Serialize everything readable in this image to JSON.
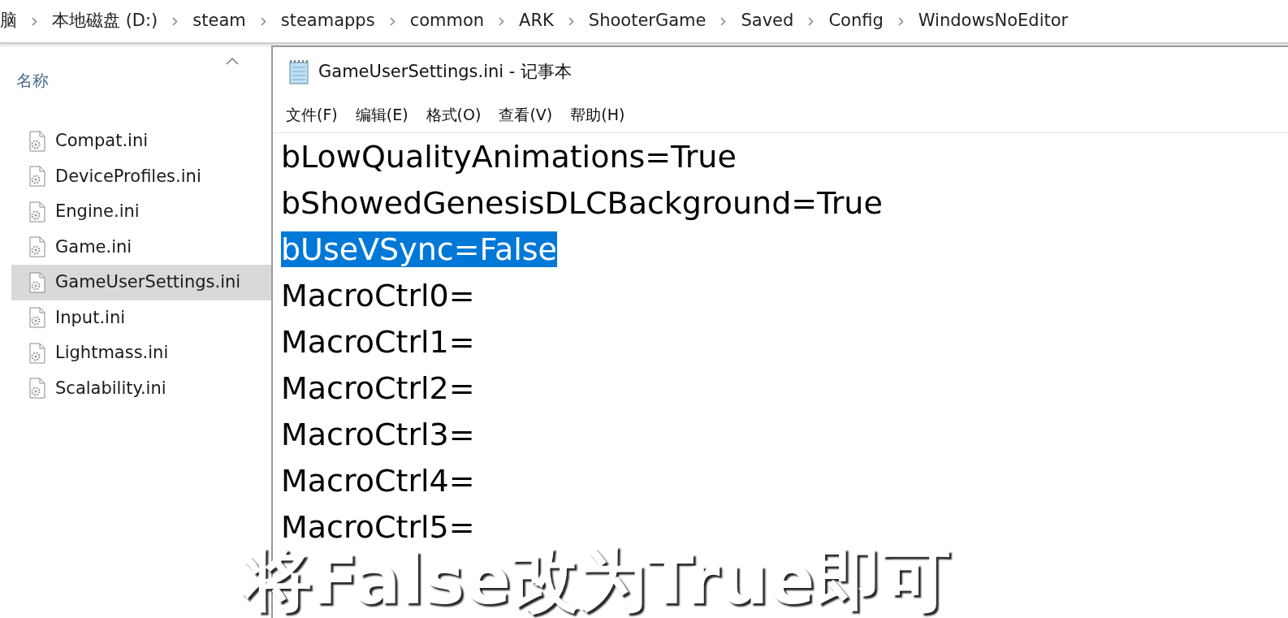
{
  "breadcrumb": [
    "脑",
    "本地磁盘 (D:)",
    "steam",
    "steamapps",
    "common",
    "ARK",
    "ShooterGame",
    "Saved",
    "Config",
    "WindowsNoEditor"
  ],
  "file_list": {
    "column_header": "名称",
    "files": [
      {
        "name": "Compat.ini",
        "selected": false
      },
      {
        "name": "DeviceProfiles.ini",
        "selected": false
      },
      {
        "name": "Engine.ini",
        "selected": false
      },
      {
        "name": "Game.ini",
        "selected": false
      },
      {
        "name": "GameUserSettings.ini",
        "selected": true
      },
      {
        "name": "Input.ini",
        "selected": false
      },
      {
        "name": "Lightmass.ini",
        "selected": false
      },
      {
        "name": "Scalability.ini",
        "selected": false
      }
    ]
  },
  "notepad": {
    "title": "GameUserSettings.ini - 记事本",
    "menu": [
      "文件(F)",
      "编辑(E)",
      "格式(O)",
      "查看(V)",
      "帮助(H)"
    ],
    "lines": [
      {
        "text": "bLowQualityAnimations=True",
        "selected": false
      },
      {
        "text": "bShowedGenesisDLCBackground=True",
        "selected": false
      },
      {
        "text": "bUseVSync=False",
        "selected": true
      },
      {
        "text": "MacroCtrl0=",
        "selected": false
      },
      {
        "text": "MacroCtrl1=",
        "selected": false
      },
      {
        "text": "MacroCtrl2=",
        "selected": false
      },
      {
        "text": "MacroCtrl3=",
        "selected": false
      },
      {
        "text": "MacroCtrl4=",
        "selected": false
      },
      {
        "text": "MacroCtrl5=",
        "selected": false
      }
    ]
  },
  "subtitle": "将False改为True即可"
}
